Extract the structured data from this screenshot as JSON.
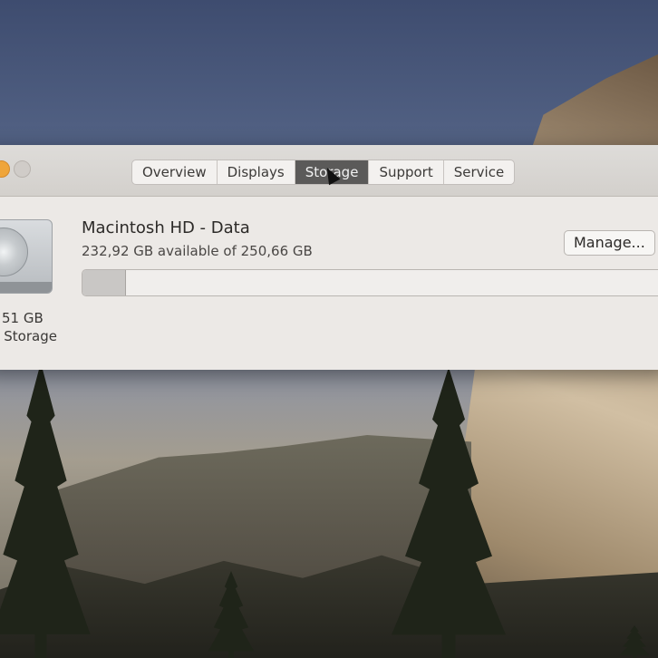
{
  "tabs": [
    {
      "label": "Overview",
      "active": false
    },
    {
      "label": "Displays",
      "active": false
    },
    {
      "label": "Storage",
      "active": true
    },
    {
      "label": "Support",
      "active": false
    },
    {
      "label": "Service",
      "active": false
    }
  ],
  "disk": {
    "size_label": "51 GB",
    "kind_label": "n Storage"
  },
  "volume": {
    "name": "Macintosh HD - Data",
    "available": "232,92 GB available of 250,66 GB",
    "used_fraction": 0.0707
  },
  "manage_button": "Manage...",
  "colors": {
    "active_tab": "#5b5a59",
    "close_button": "#efa53a",
    "usage_fill": "#c9c7c5"
  }
}
